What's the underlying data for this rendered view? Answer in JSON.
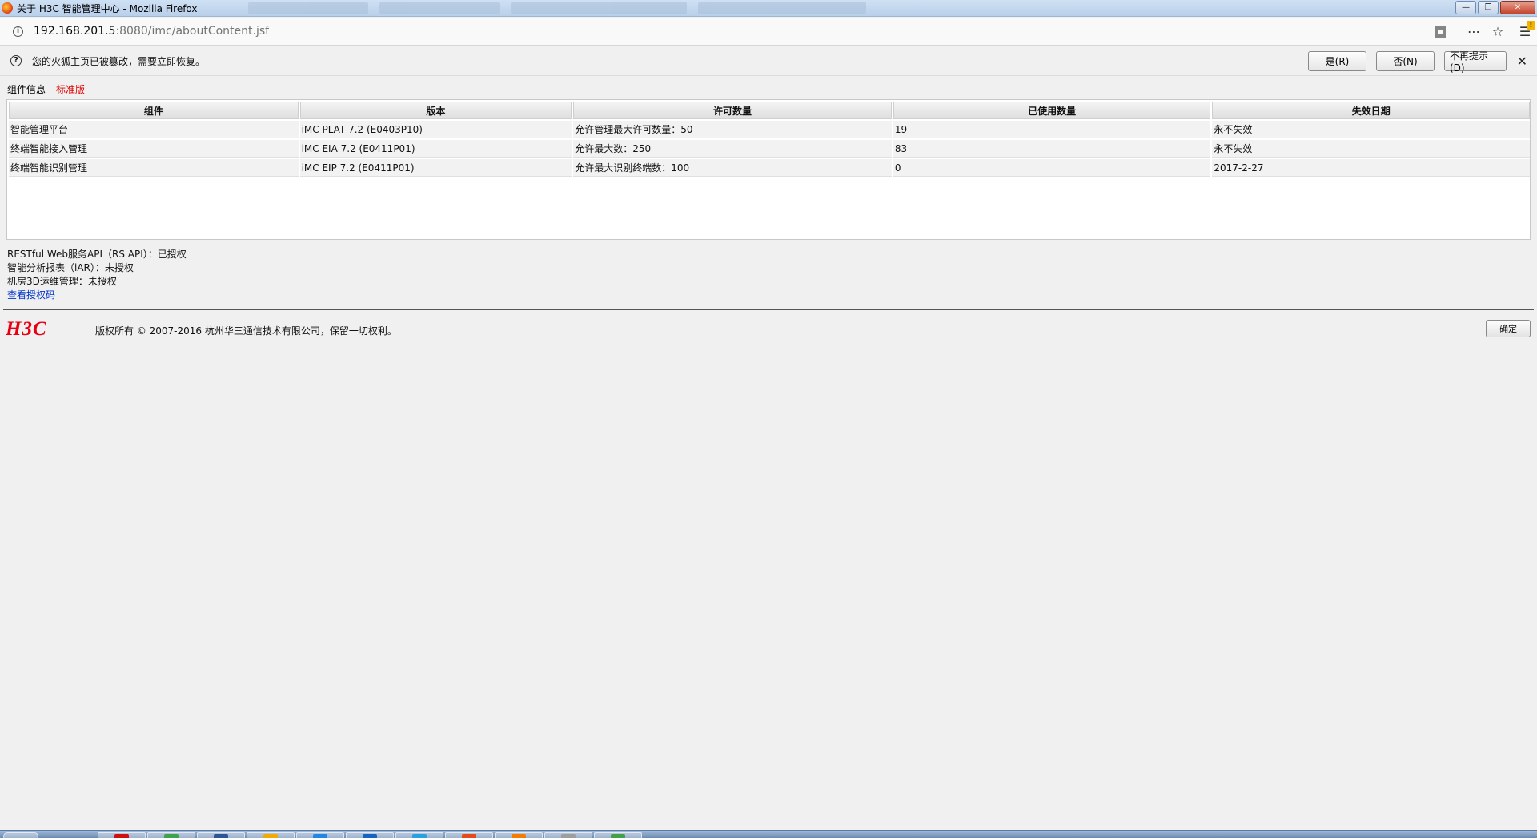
{
  "window": {
    "title": "关于 H3C 智能管理中心 - Mozilla Firefox",
    "controls": [
      "minimize-icon",
      "maximize-icon",
      "close-icon"
    ]
  },
  "address_bar": {
    "url_host": "192.168.201.5",
    "url_rest": ":8080/imc/aboutContent.jsf"
  },
  "notification": {
    "message": "您的火狐主页已被篡改，需要立即恢复。",
    "yes_label": "是(R)",
    "no_label": "否(N)",
    "never_label": "不再提示(D)"
  },
  "tabs": {
    "components": "组件信息",
    "edition": "标准版"
  },
  "colors": {
    "edition_tab": "#e00000",
    "link": "#0033cc",
    "logo": "#e60012"
  },
  "table": {
    "headers": [
      "组件",
      "版本",
      "许可数量",
      "已使用数量",
      "失效日期"
    ],
    "rows": [
      [
        "智能管理平台",
        "iMC PLAT 7.2 (E0403P10)",
        "允许管理最大许可数量：50",
        "19",
        "永不失效"
      ],
      [
        "终端智能接入管理",
        "iMC EIA 7.2 (E0411P01)",
        "允许最大数：250",
        "83",
        "永不失效"
      ],
      [
        "终端智能识别管理",
        "iMC EIP 7.2 (E0411P01)",
        "允许最大识别终端数：100",
        "0",
        "2017-2-27"
      ]
    ]
  },
  "licenses": {
    "rs_api": "RESTful Web服务API（RS API）：已授权",
    "iar": "智能分析报表（iAR）：未授权",
    "datacenter_3d": "机房3D运维管理：未授权",
    "view_code_link": "查看授权码"
  },
  "footer": {
    "logo_text": "H3C",
    "copyright": "版权所有 © 2007-2016 杭州华三通信技术有限公司，保留一切权利。",
    "ok_label": "确定"
  }
}
